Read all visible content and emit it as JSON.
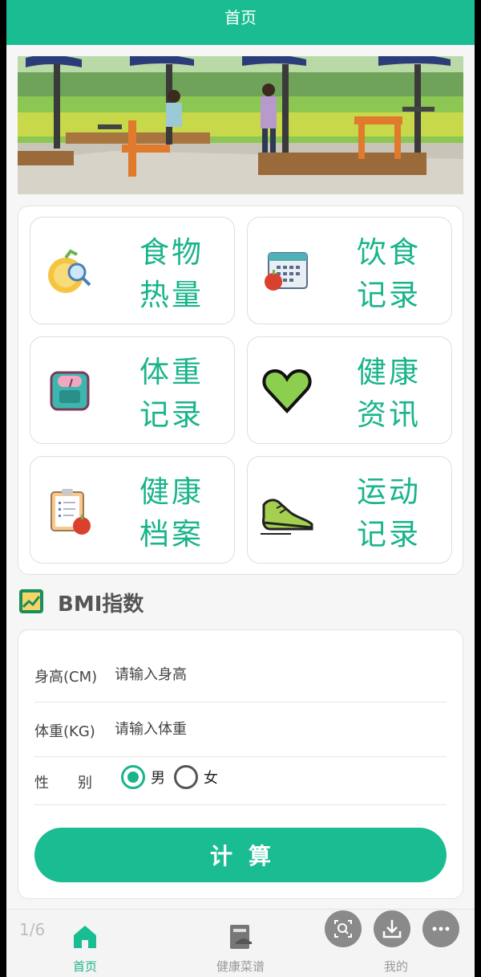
{
  "header": {
    "title": "首页"
  },
  "tiles": [
    {
      "label": "食物热量",
      "icon": "food-calorie-icon"
    },
    {
      "label": "饮食记录",
      "icon": "diet-record-icon"
    },
    {
      "label": "体重记录",
      "icon": "weight-scale-icon"
    },
    {
      "label": "健康资讯",
      "icon": "heart-icon"
    },
    {
      "label": "健康档案",
      "icon": "health-file-icon"
    },
    {
      "label": "运动记录",
      "icon": "sneaker-icon"
    }
  ],
  "bmi": {
    "title": "BMI指数",
    "height_label": "身高(CM)",
    "height_placeholder": "请输入身高",
    "weight_label": "体重(KG)",
    "weight_placeholder": "请输入体重",
    "gender_label": "性　　别",
    "male": "男",
    "female": "女",
    "selected_gender": "男",
    "calc_button": "计算"
  },
  "tabbar": {
    "home": "首页",
    "recipes": "健康菜谱",
    "mine": "我的",
    "active": "首页"
  },
  "overlay": {
    "pager": "1/6"
  },
  "colors": {
    "accent": "#1abd92",
    "accent_text": "#1ab48b",
    "background": "#f6f6f6"
  }
}
